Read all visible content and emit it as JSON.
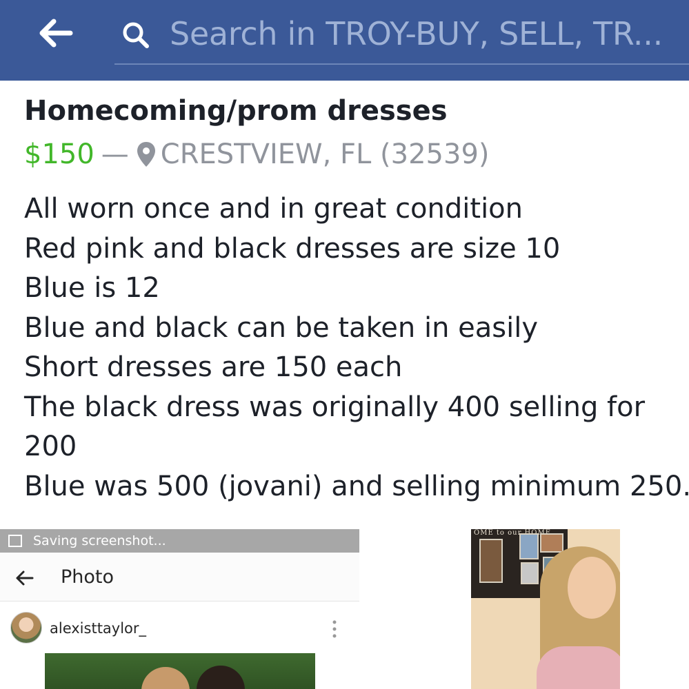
{
  "topbar": {
    "background": "#3b5998",
    "back_icon": "back-arrow-icon",
    "search_icon": "search-icon",
    "search_text": "Search in TROY-BUY, SELL, TR..."
  },
  "listing": {
    "title": "Homecoming/prom dresses",
    "price": "$150",
    "separator": "—",
    "location_icon": "location-pin-icon",
    "location": "CRESTVIEW, FL (32539)",
    "description": [
      "All worn once and in great condition",
      "Red pink and black dresses are size 10",
      "Blue is 12",
      "Blue and black can be taken in easily",
      "Short dresses are 150 each",
      "The black dress was originally 400 selling for",
      "200",
      "Blue was 500 (jovani) and selling minimum 250."
    ],
    "colors": {
      "price": "#42b72a",
      "location": "#90949c",
      "text": "#1d2129"
    }
  },
  "photos": {
    "photo1": {
      "status_text": "Saving screenshot...",
      "header_title": "Photo",
      "username": "alexisttaylor_",
      "more_icon": "more-vertical-icon"
    },
    "photo2": {
      "sign_text": "OME to our HOME"
    }
  }
}
